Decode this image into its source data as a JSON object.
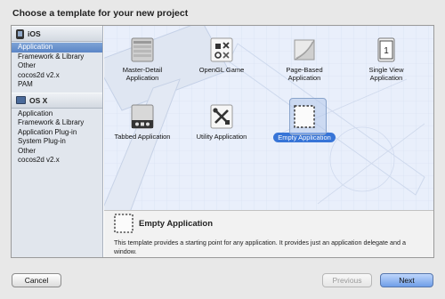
{
  "dialog": {
    "title": "Choose a template for your new project"
  },
  "sidebar": {
    "sections": [
      {
        "header": "iOS",
        "icon": "iphone-icon",
        "items": [
          "Application",
          "Framework & Library",
          "Other",
          "cocos2d v2.x",
          "PAM"
        ]
      },
      {
        "header": "OS X",
        "icon": "mac-icon",
        "items": [
          "Application",
          "Framework & Library",
          "Application Plug-in",
          "System Plug-in",
          "Other",
          "cocos2d v2.x"
        ]
      }
    ],
    "selected": "iOS/Application"
  },
  "templates": [
    {
      "label": "Master-Detail\nApplication",
      "icon": "master-detail-icon"
    },
    {
      "label": "OpenGL Game",
      "icon": "opengl-game-icon"
    },
    {
      "label": "Page-Based\nApplication",
      "icon": "page-based-icon"
    },
    {
      "label": "Single View\nApplication",
      "icon": "single-view-icon"
    },
    {
      "label": "Tabbed Application",
      "icon": "tabbed-icon"
    },
    {
      "label": "Utility Application",
      "icon": "utility-icon"
    },
    {
      "label": "Empty Application",
      "icon": "empty-app-icon",
      "selected": true
    }
  ],
  "detail": {
    "title": "Empty Application",
    "description": "This template provides a starting point for any application. It provides just an application delegate and a window."
  },
  "buttons": {
    "cancel": "Cancel",
    "previous": "Previous",
    "next": "Next"
  },
  "colors": {
    "selection": "#3875d7",
    "sidebar_selection": "#5a85c6",
    "blueprint": "#e7eefb"
  }
}
